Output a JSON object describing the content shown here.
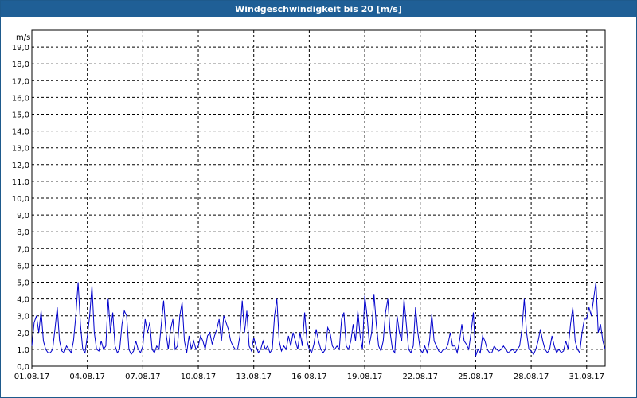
{
  "window": {
    "title": "Windgeschwindigkeit bis 20 [m/s]"
  },
  "colors": {
    "title_bar": "#1f5f96",
    "line": "#0000cc",
    "grid": "#000000"
  },
  "chart_data": {
    "type": "line",
    "title": "Windgeschwindigkeit bis 20 [m/s]",
    "ylabel": "m/s",
    "xlabel": "",
    "xlim": [
      "01.08.17",
      "01.09.17"
    ],
    "ylim": [
      0,
      20
    ],
    "grid": true,
    "y_ticks": [
      0,
      1,
      2,
      3,
      4,
      5,
      6,
      7,
      8,
      9,
      10,
      11,
      12,
      13,
      14,
      15,
      16,
      17,
      18,
      19
    ],
    "y_tick_labels": [
      "0,0",
      "1,0",
      "2,0",
      "3,0",
      "4,0",
      "5,0",
      "6,0",
      "7,0",
      "8,0",
      "9,0",
      "10,0",
      "11,0",
      "12,0",
      "13,0",
      "14,0",
      "15,0",
      "16,0",
      "17,0",
      "18,0",
      "19,0"
    ],
    "x_ticks": [
      "01.08.17",
      "04.08.17",
      "07.08.17",
      "10.08.17",
      "13.08.17",
      "16.08.17",
      "19.08.17",
      "22.08.17",
      "25.08.17",
      "28.08.17",
      "31.08.17"
    ],
    "series": [
      {
        "x": [
          "2017-08-01 00:00",
          "2017-08-01 03:00",
          "2017-08-01 06:00",
          "2017-08-01 09:00",
          "2017-08-01 12:00",
          "2017-08-01 15:00",
          "2017-08-01 18:00",
          "2017-08-01 21:00",
          "2017-08-02 00:00",
          "2017-08-02 03:00",
          "2017-08-02 06:00",
          "2017-08-02 09:00",
          "2017-08-02 12:00",
          "2017-08-02 15:00",
          "2017-08-02 18:00",
          "2017-08-02 21:00",
          "2017-08-03 00:00",
          "2017-08-03 03:00",
          "2017-08-03 06:00",
          "2017-08-03 09:00",
          "2017-08-03 12:00",
          "2017-08-03 15:00",
          "2017-08-03 18:00",
          "2017-08-03 21:00",
          "2017-08-04 00:00",
          "2017-08-04 03:00",
          "2017-08-04 06:00",
          "2017-08-04 09:00",
          "2017-08-04 12:00",
          "2017-08-04 15:00",
          "2017-08-04 18:00",
          "2017-08-04 21:00",
          "2017-08-05 00:00",
          "2017-08-05 03:00",
          "2017-08-05 06:00",
          "2017-08-05 09:00",
          "2017-08-05 12:00",
          "2017-08-05 15:00",
          "2017-08-05 18:00",
          "2017-08-05 21:00",
          "2017-08-06 00:00",
          "2017-08-06 03:00",
          "2017-08-06 06:00",
          "2017-08-06 09:00",
          "2017-08-06 12:00",
          "2017-08-06 15:00",
          "2017-08-06 18:00",
          "2017-08-06 21:00",
          "2017-08-07 00:00",
          "2017-08-07 03:00",
          "2017-08-07 06:00",
          "2017-08-07 09:00",
          "2017-08-07 12:00",
          "2017-08-07 15:00",
          "2017-08-07 18:00",
          "2017-08-07 21:00",
          "2017-08-08 00:00",
          "2017-08-08 03:00",
          "2017-08-08 06:00",
          "2017-08-08 09:00",
          "2017-08-08 12:00",
          "2017-08-08 15:00",
          "2017-08-08 18:00",
          "2017-08-08 21:00",
          "2017-08-09 00:00",
          "2017-08-09 03:00",
          "2017-08-09 06:00",
          "2017-08-09 09:00",
          "2017-08-09 12:00",
          "2017-08-09 15:00",
          "2017-08-09 18:00",
          "2017-08-09 21:00",
          "2017-08-10 00:00",
          "2017-08-10 03:00",
          "2017-08-10 06:00",
          "2017-08-10 09:00",
          "2017-08-10 12:00",
          "2017-08-10 15:00",
          "2017-08-10 18:00",
          "2017-08-10 21:00",
          "2017-08-11 00:00",
          "2017-08-11 03:00",
          "2017-08-11 06:00",
          "2017-08-11 09:00",
          "2017-08-11 12:00",
          "2017-08-11 15:00",
          "2017-08-11 18:00",
          "2017-08-11 21:00",
          "2017-08-12 00:00",
          "2017-08-12 03:00",
          "2017-08-12 06:00",
          "2017-08-12 09:00",
          "2017-08-12 12:00",
          "2017-08-12 15:00",
          "2017-08-12 18:00",
          "2017-08-12 21:00",
          "2017-08-13 00:00",
          "2017-08-13 03:00",
          "2017-08-13 06:00",
          "2017-08-13 09:00",
          "2017-08-13 12:00",
          "2017-08-13 15:00",
          "2017-08-13 18:00",
          "2017-08-13 21:00",
          "2017-08-14 00:00",
          "2017-08-14 03:00",
          "2017-08-14 06:00",
          "2017-08-14 09:00",
          "2017-08-14 12:00",
          "2017-08-14 15:00",
          "2017-08-14 18:00",
          "2017-08-14 21:00",
          "2017-08-15 00:00",
          "2017-08-15 03:00",
          "2017-08-15 06:00",
          "2017-08-15 09:00",
          "2017-08-15 12:00",
          "2017-08-15 15:00",
          "2017-08-15 18:00",
          "2017-08-15 21:00",
          "2017-08-16 00:00",
          "2017-08-16 03:00",
          "2017-08-16 06:00",
          "2017-08-16 09:00",
          "2017-08-16 12:00",
          "2017-08-16 15:00",
          "2017-08-16 18:00",
          "2017-08-16 21:00",
          "2017-08-17 00:00",
          "2017-08-17 03:00",
          "2017-08-17 06:00",
          "2017-08-17 09:00",
          "2017-08-17 12:00",
          "2017-08-17 15:00",
          "2017-08-17 18:00",
          "2017-08-17 21:00",
          "2017-08-18 00:00",
          "2017-08-18 03:00",
          "2017-08-18 06:00",
          "2017-08-18 09:00",
          "2017-08-18 12:00",
          "2017-08-18 15:00",
          "2017-08-18 18:00",
          "2017-08-18 21:00",
          "2017-08-19 00:00",
          "2017-08-19 03:00",
          "2017-08-19 06:00",
          "2017-08-19 09:00",
          "2017-08-19 12:00",
          "2017-08-19 15:00",
          "2017-08-19 18:00",
          "2017-08-19 21:00",
          "2017-08-20 00:00",
          "2017-08-20 03:00",
          "2017-08-20 06:00",
          "2017-08-20 09:00",
          "2017-08-20 12:00",
          "2017-08-20 15:00",
          "2017-08-20 18:00",
          "2017-08-20 21:00",
          "2017-08-21 00:00",
          "2017-08-21 03:00",
          "2017-08-21 06:00",
          "2017-08-21 09:00",
          "2017-08-21 12:00",
          "2017-08-21 15:00",
          "2017-08-21 18:00",
          "2017-08-21 21:00",
          "2017-08-22 00:00",
          "2017-08-22 03:00",
          "2017-08-22 06:00",
          "2017-08-22 09:00",
          "2017-08-22 12:00",
          "2017-08-22 15:00",
          "2017-08-22 18:00",
          "2017-08-22 21:00",
          "2017-08-23 00:00",
          "2017-08-23 03:00",
          "2017-08-23 06:00",
          "2017-08-23 09:00",
          "2017-08-23 12:00",
          "2017-08-23 15:00",
          "2017-08-23 18:00",
          "2017-08-23 21:00",
          "2017-08-24 00:00",
          "2017-08-24 03:00",
          "2017-08-24 06:00",
          "2017-08-24 09:00",
          "2017-08-24 12:00",
          "2017-08-24 15:00",
          "2017-08-24 18:00",
          "2017-08-24 21:00",
          "2017-08-25 00:00",
          "2017-08-25 03:00",
          "2017-08-25 06:00",
          "2017-08-25 09:00",
          "2017-08-25 12:00",
          "2017-08-25 15:00",
          "2017-08-25 18:00",
          "2017-08-25 21:00",
          "2017-08-26 00:00",
          "2017-08-26 03:00",
          "2017-08-26 06:00",
          "2017-08-26 09:00",
          "2017-08-26 12:00",
          "2017-08-26 15:00",
          "2017-08-26 18:00",
          "2017-08-26 21:00",
          "2017-08-27 00:00",
          "2017-08-27 03:00",
          "2017-08-27 06:00",
          "2017-08-27 09:00",
          "2017-08-27 12:00",
          "2017-08-27 15:00",
          "2017-08-27 18:00",
          "2017-08-27 21:00",
          "2017-08-28 00:00",
          "2017-08-28 03:00",
          "2017-08-28 06:00",
          "2017-08-28 09:00",
          "2017-08-28 12:00",
          "2017-08-28 15:00",
          "2017-08-28 18:00",
          "2017-08-28 21:00",
          "2017-08-29 00:00",
          "2017-08-29 03:00",
          "2017-08-29 06:00",
          "2017-08-29 09:00",
          "2017-08-29 12:00",
          "2017-08-29 15:00",
          "2017-08-29 18:00",
          "2017-08-29 21:00",
          "2017-08-30 00:00",
          "2017-08-30 03:00",
          "2017-08-30 06:00",
          "2017-08-30 09:00",
          "2017-08-30 12:00",
          "2017-08-30 15:00",
          "2017-08-30 18:00",
          "2017-08-30 21:00",
          "2017-08-31 00:00",
          "2017-08-31 03:00",
          "2017-08-31 06:00",
          "2017-08-31 09:00",
          "2017-08-31 12:00",
          "2017-08-31 15:00",
          "2017-08-31 18:00",
          "2017-08-31 21:00",
          "2017-09-01 00:00"
        ],
        "values": [
          1.2,
          2.6,
          3.0,
          2.0,
          3.3,
          1.5,
          1.0,
          0.8,
          0.8,
          1.0,
          2.2,
          3.5,
          1.5,
          0.9,
          0.8,
          1.2,
          1.0,
          0.8,
          1.5,
          3.0,
          5.0,
          2.5,
          1.0,
          0.8,
          1.8,
          3.0,
          4.8,
          2.0,
          1.0,
          0.9,
          1.5,
          1.0,
          1.2,
          4.0,
          2.0,
          3.2,
          1.2,
          0.8,
          1.0,
          2.5,
          3.3,
          3.0,
          1.0,
          0.7,
          0.9,
          1.5,
          1.0,
          0.8,
          1.2,
          2.8,
          2.0,
          2.6,
          1.0,
          0.8,
          1.2,
          1.0,
          2.5,
          3.9,
          2.0,
          1.0,
          2.2,
          2.8,
          1.0,
          1.2,
          3.0,
          3.8,
          1.5,
          0.8,
          1.8,
          1.0,
          1.5,
          1.0,
          1.2,
          1.8,
          1.5,
          1.0,
          1.8,
          2.0,
          1.3,
          1.8,
          2.2,
          2.8,
          1.5,
          3.0,
          2.6,
          2.2,
          1.5,
          1.2,
          1.0,
          1.0,
          1.8,
          3.9,
          2.0,
          3.3,
          1.2,
          0.9,
          1.7,
          1.2,
          0.8,
          1.0,
          1.5,
          1.0,
          1.2,
          0.8,
          1.0,
          3.0,
          4.0,
          1.5,
          0.9,
          1.2,
          1.0,
          1.8,
          1.2,
          2.0,
          1.5,
          1.0,
          2.0,
          1.2,
          3.2,
          1.5,
          1.0,
          0.8,
          1.3,
          2.2,
          1.5,
          1.0,
          0.8,
          1.0,
          2.3,
          2.0,
          1.2,
          1.0,
          1.2,
          1.0,
          2.8,
          3.2,
          1.2,
          1.0,
          1.5,
          2.5,
          1.5,
          3.3,
          1.8,
          1.0,
          4.2,
          3.0,
          1.3,
          2.0,
          4.3,
          2.5,
          1.2,
          0.9,
          1.5,
          3.2,
          4.0,
          2.0,
          1.0,
          0.8,
          3.0,
          2.0,
          1.5,
          4.0,
          2.5,
          1.0,
          0.8,
          1.2,
          3.5,
          2.0,
          1.0,
          0.8,
          1.2,
          0.8,
          1.5,
          3.1,
          1.5,
          1.2,
          0.9,
          0.8,
          1.0,
          1.0,
          1.3,
          2.0,
          1.2,
          1.2,
          0.8,
          1.5,
          2.5,
          1.5,
          1.3,
          1.0,
          2.0,
          3.2,
          0.6,
          1.0,
          0.8,
          1.8,
          1.5,
          1.0,
          0.8,
          0.8,
          1.2,
          1.0,
          0.9,
          1.0,
          1.2,
          1.0,
          0.8,
          0.9,
          1.0,
          0.8,
          1.0,
          1.2,
          2.2,
          4.0,
          2.0,
          1.0,
          0.9,
          0.7,
          1.0,
          1.5,
          2.2,
          1.5,
          1.0,
          0.8,
          1.0,
          1.8,
          1.2,
          0.8,
          1.0,
          0.8,
          0.9,
          1.5,
          1.0,
          2.5,
          3.5,
          1.5,
          1.0,
          0.8,
          2.0,
          2.8,
          2.8,
          3.5,
          3.0,
          4.0,
          5.0,
          2.0,
          2.5,
          1.5,
          1.0
        ]
      }
    ]
  }
}
